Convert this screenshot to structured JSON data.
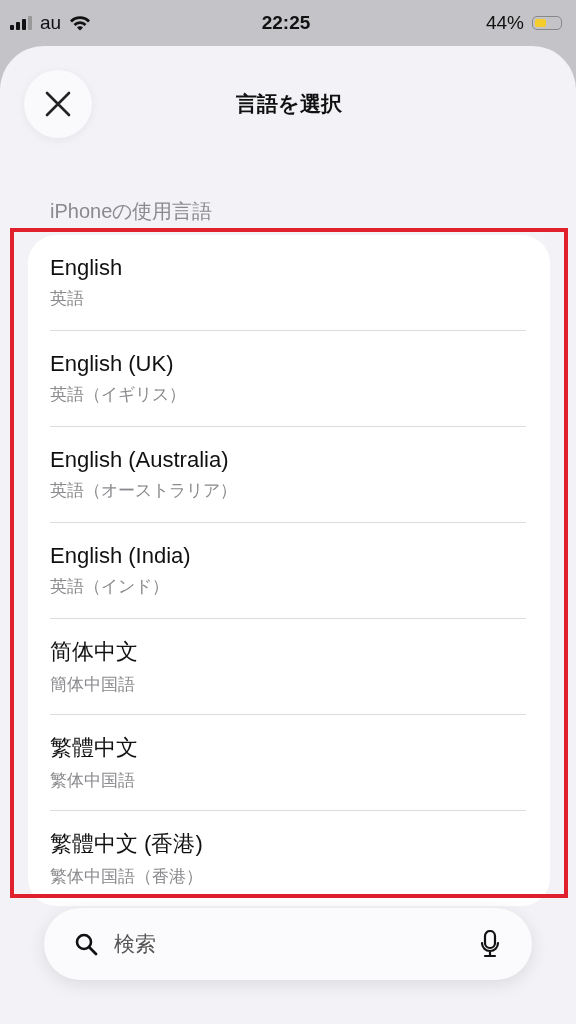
{
  "status_bar": {
    "carrier": "au",
    "time": "22:25",
    "battery_percent": "44%"
  },
  "sheet": {
    "title": "言語を選択"
  },
  "section": {
    "header": "iPhoneの使用言語",
    "highlighted": true,
    "languages": [
      {
        "name": "English",
        "translation": "英語"
      },
      {
        "name": "English (UK)",
        "translation": "英語（イギリス）"
      },
      {
        "name": "English (Australia)",
        "translation": "英語（オーストラリア）"
      },
      {
        "name": "English (India)",
        "translation": "英語（インド）"
      },
      {
        "name": "简体中文",
        "translation": "簡体中国語"
      },
      {
        "name": "繁體中文",
        "translation": "繁体中国語"
      },
      {
        "name": "繁體中文 (香港)",
        "translation": "繁体中国語（香港）"
      }
    ]
  },
  "search": {
    "placeholder": "検索"
  }
}
